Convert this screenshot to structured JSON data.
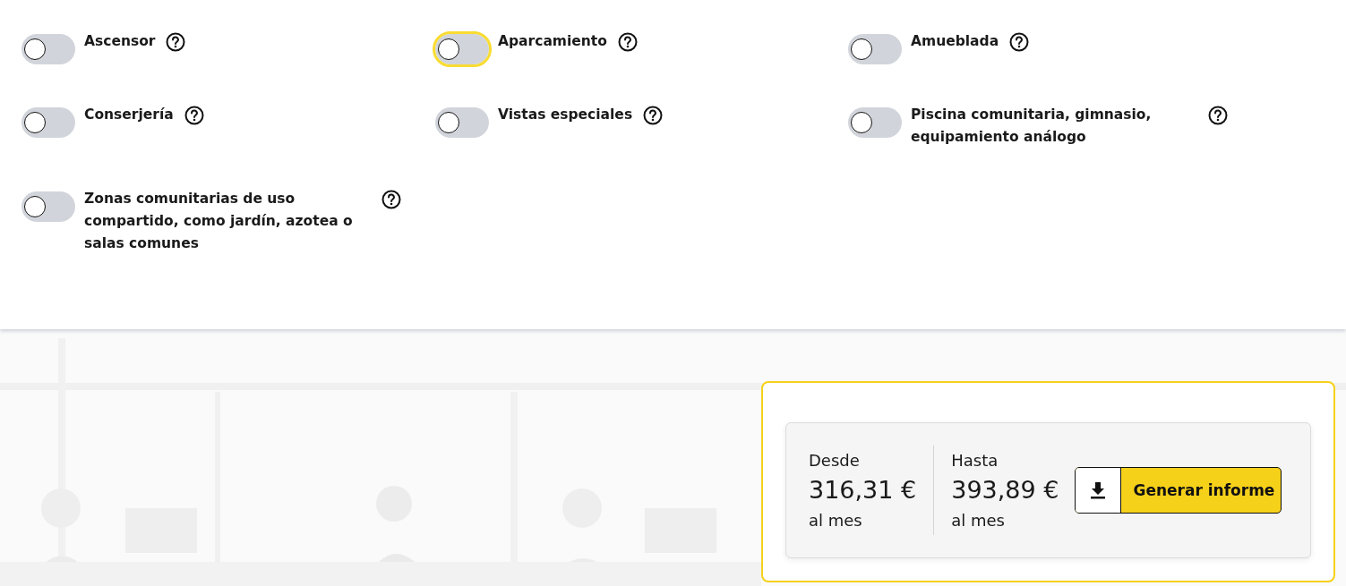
{
  "features": [
    {
      "label": "Ascensor",
      "on": false,
      "focused": false
    },
    {
      "label": "Aparcamiento",
      "on": false,
      "focused": true
    },
    {
      "label": "Amueblada",
      "on": false,
      "focused": false
    },
    {
      "label": "Conserjería",
      "on": false,
      "focused": false
    },
    {
      "label": "Vistas especiales",
      "on": false,
      "focused": false
    },
    {
      "label": "Piscina comunitaria, gimnasio, equipamiento análogo",
      "on": false,
      "focused": false
    },
    {
      "label": "Zonas comunitarias de uso compartido, como jardín, azotea o salas comunes",
      "on": false,
      "focused": false
    }
  ],
  "estimate": {
    "ranges": [
      {
        "label": "Desde",
        "amount": "316,31 €",
        "period": "al mes"
      },
      {
        "label": "Hasta",
        "amount": "393,89 €",
        "period": "al mes"
      }
    ],
    "button": "Generar informe"
  }
}
